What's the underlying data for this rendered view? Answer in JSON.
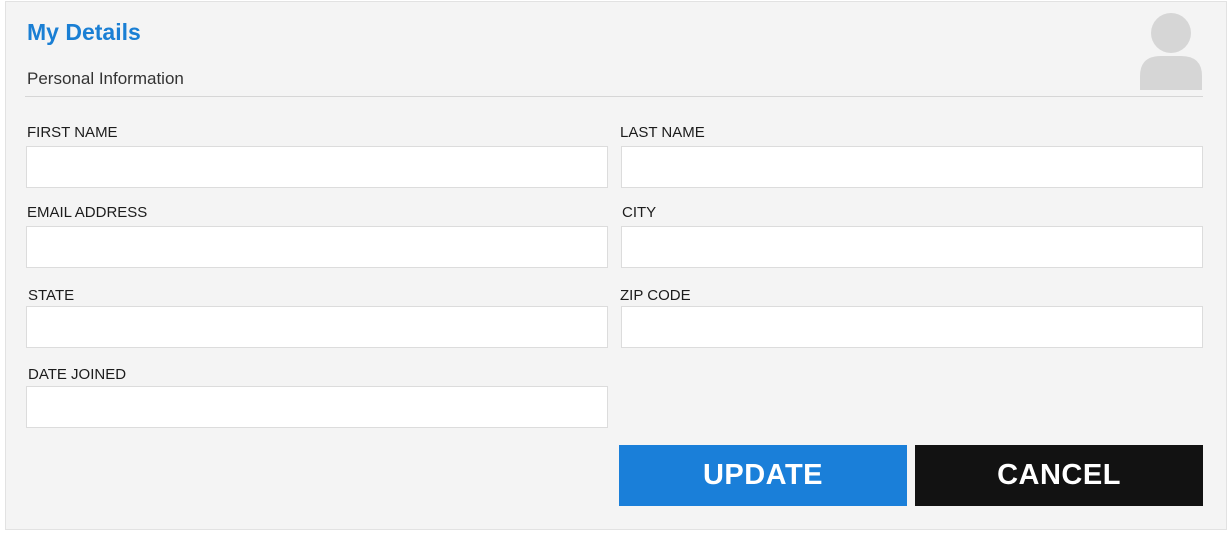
{
  "header": {
    "title": "My Details",
    "subtitle": "Personal Information",
    "avatar_icon": "user-avatar-icon"
  },
  "form": {
    "first_name": {
      "label": "FIRST NAME",
      "value": "",
      "placeholder": ""
    },
    "last_name": {
      "label": "LAST NAME",
      "value": "",
      "placeholder": ""
    },
    "email": {
      "label": "EMAIL ADDRESS",
      "value": "",
      "placeholder": ""
    },
    "city": {
      "label": "CITY",
      "value": "",
      "placeholder": ""
    },
    "state": {
      "label": "STATE",
      "value": "",
      "placeholder": ""
    },
    "zip": {
      "label": "ZIP CODE",
      "value": "",
      "placeholder": ""
    },
    "date_joined": {
      "label": "DATE JOINED",
      "value": "",
      "placeholder": ""
    }
  },
  "actions": {
    "update_label": "UPDATE",
    "cancel_label": "CANCEL"
  },
  "colors": {
    "accent": "#1a7fd4",
    "update_bg": "#1a7fd9",
    "cancel_bg": "#121212",
    "panel_bg": "#f4f4f4",
    "avatar": "#d6d6d6"
  }
}
